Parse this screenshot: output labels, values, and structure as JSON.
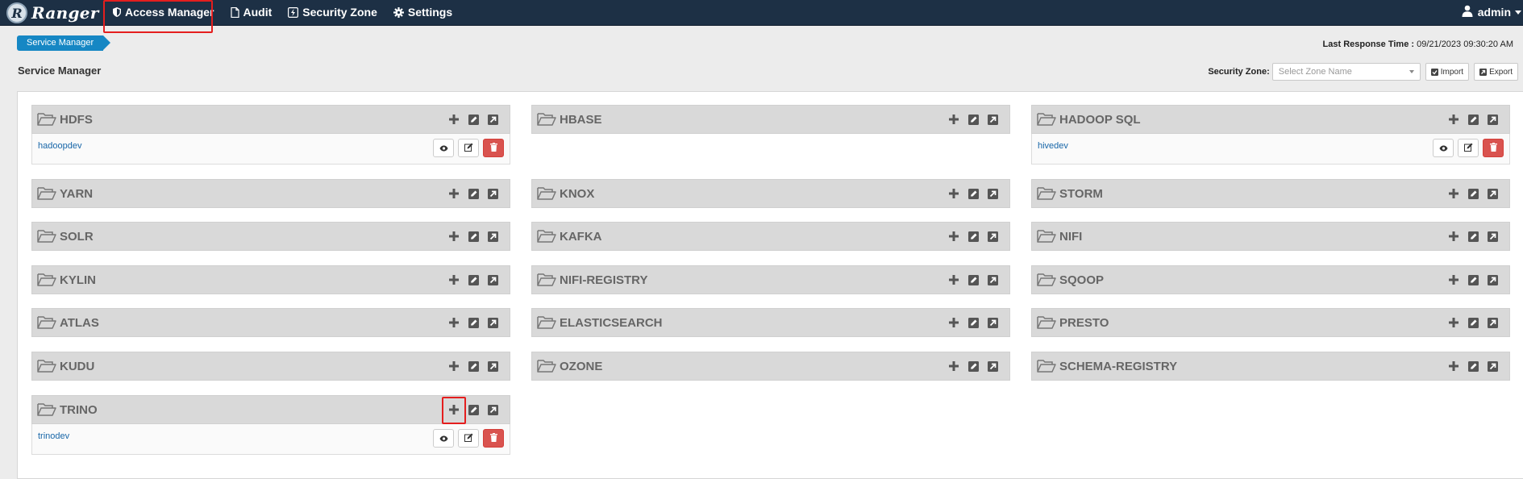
{
  "app": {
    "brand": "Ranger",
    "logo_letter": "R"
  },
  "nav": {
    "items": [
      {
        "label": "Access Manager",
        "icon": "shield-icon"
      },
      {
        "label": "Audit",
        "icon": "file-icon"
      },
      {
        "label": "Security Zone",
        "icon": "zone-icon"
      },
      {
        "label": "Settings",
        "icon": "gear-icon"
      }
    ],
    "user": "admin"
  },
  "breadcrumb": "Service Manager",
  "last_response": {
    "label": "Last Response Time :",
    "value": "09/21/2023 09:30:20 AM"
  },
  "page_title": "Service Manager",
  "security_zone": {
    "label": "Security Zone:",
    "placeholder": "Select Zone Name"
  },
  "toolbar": {
    "import_label": "Import",
    "export_label": "Export"
  },
  "colors": {
    "nav_bg": "#1d3045",
    "breadcrumb_bg": "#1687c4",
    "delete_bg": "#d9534f",
    "link": "#1766a8",
    "highlight": "#e41e1e"
  },
  "services": [
    {
      "name": "HDFS",
      "instances": [
        "hadoopdev"
      ]
    },
    {
      "name": "HBASE",
      "instances": []
    },
    {
      "name": "HADOOP SQL",
      "instances": [
        "hivedev"
      ]
    },
    {
      "name": "YARN",
      "instances": []
    },
    {
      "name": "KNOX",
      "instances": []
    },
    {
      "name": "STORM",
      "instances": []
    },
    {
      "name": "SOLR",
      "instances": []
    },
    {
      "name": "KAFKA",
      "instances": []
    },
    {
      "name": "NIFI",
      "instances": []
    },
    {
      "name": "KYLIN",
      "instances": []
    },
    {
      "name": "NIFI-REGISTRY",
      "instances": []
    },
    {
      "name": "SQOOP",
      "instances": []
    },
    {
      "name": "ATLAS",
      "instances": []
    },
    {
      "name": "ELASTICSEARCH",
      "instances": []
    },
    {
      "name": "PRESTO",
      "instances": []
    },
    {
      "name": "KUDU",
      "instances": []
    },
    {
      "name": "OZONE",
      "instances": []
    },
    {
      "name": "SCHEMA-REGISTRY",
      "instances": []
    },
    {
      "name": "TRINO",
      "instances": [
        "trinodev"
      ]
    }
  ]
}
